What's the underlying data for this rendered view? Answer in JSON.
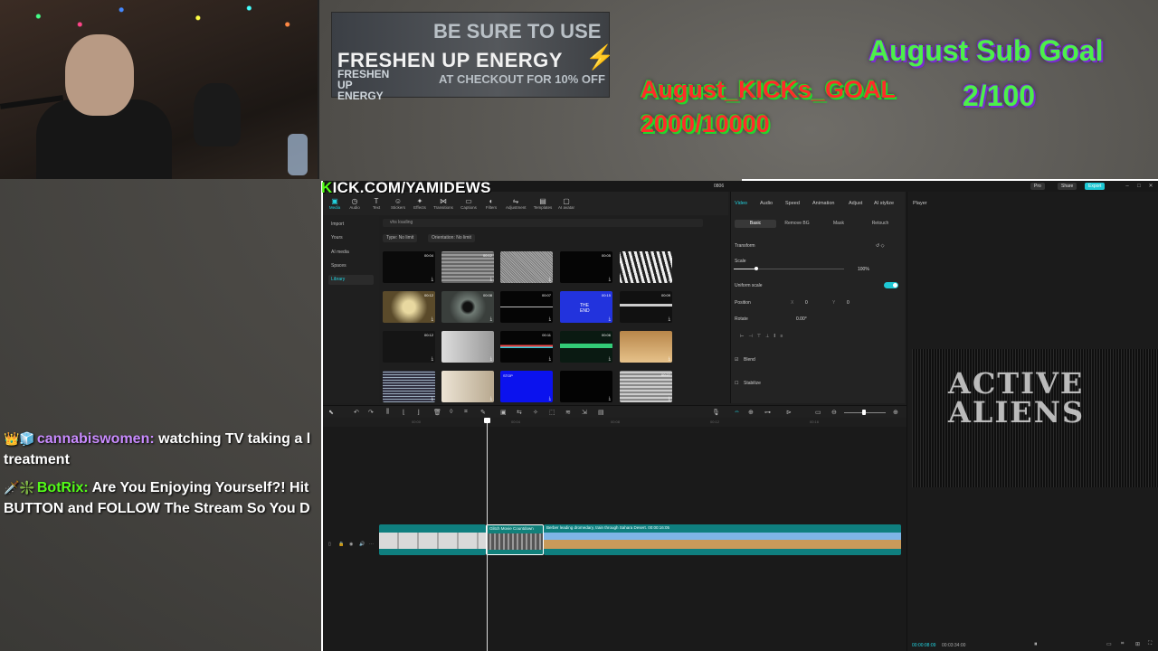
{
  "overlay": {
    "banner": {
      "be_sure": "BE SURE TO USE",
      "brand": "FRESHEN UP ENERGY",
      "brand_small": "FRESHEN UP ENERGY",
      "checkout": "AT CHECKOUT FOR 10% OFF"
    },
    "sub_goal": {
      "title": "August Sub Goal",
      "value": "2/100"
    },
    "kicks_goal": {
      "title": "August_KICKs_GOAL",
      "value": "2000/10000"
    },
    "kick_url_k": "K",
    "kick_url_rest": "ICK.COM/YAMIDEWS"
  },
  "chat": [
    {
      "badges": "👑🧊",
      "user": "cannabiswomen:",
      "text": " watching TV taking a l",
      "text2": "treatment"
    },
    {
      "badges": "🗡️❇️",
      "user": "BotRix:",
      "text": " Are You Enjoying Yourself?! Hit",
      "text2": "BUTTON and FOLLOW The Stream So You D"
    }
  ],
  "editor": {
    "center_title": "0806",
    "pro": "Pro",
    "share": "Share",
    "export": "Export",
    "media_tabs": [
      "Media",
      "Audio",
      "Text",
      "Stickers",
      "Effects",
      "Transitions",
      "Captions",
      "Filters",
      "Adjustment",
      "Templates",
      "AI avatar"
    ],
    "library_items": [
      "Import",
      "Yours",
      "AI media",
      "Spaces",
      "Library"
    ],
    "search_text": "vhs loading",
    "filters": [
      "Type: No limit",
      "Orientation: No limit"
    ],
    "thumbs": [
      {
        "dur": "00:04"
      },
      {
        "dur": "00:12"
      },
      {
        "dur": ""
      },
      {
        "dur": "00:05"
      },
      {
        "dur": ""
      },
      {
        "dur": "00:12"
      },
      {
        "dur": "00:08"
      },
      {
        "dur": "00:07"
      },
      {
        "dur": "00:15"
      },
      {
        "dur": "00:09"
      },
      {
        "dur": "00:12"
      },
      {
        "dur": ""
      },
      {
        "dur": "00:11"
      },
      {
        "dur": "00:06"
      },
      {
        "dur": ""
      },
      {
        "dur": ""
      },
      {
        "dur": ""
      },
      {
        "dur": ""
      },
      {
        "dur": ""
      },
      {
        "dur": "00:27"
      }
    ],
    "thumb_texts": {
      "the_end": "THE END",
      "stop": "STOP"
    },
    "inspector": {
      "tabs": [
        "Video",
        "Audio",
        "Speed",
        "Animation",
        "Adjust",
        "AI stylize"
      ],
      "subtabs": [
        "Basic",
        "Remove BG",
        "Mask",
        "Retouch"
      ],
      "transform": "Transform",
      "scale": "Scale",
      "scale_value": "100%",
      "uniform_scale": "Uniform scale",
      "position": "Position",
      "pos_x_label": "X",
      "pos_x": "0",
      "pos_y_label": "Y",
      "pos_y": "0",
      "rotate": "Rotate",
      "rotate_value": "0.00°",
      "blend": "Blend",
      "stabilize": "Stabilize"
    },
    "player": {
      "label": "Player",
      "glitch_text": "ACTIVE ALIENS",
      "time_current": "00:00:08:09",
      "time_total": "00:03:34:00"
    },
    "ruler": [
      "00:00",
      "00:04",
      "00:08",
      "00:12",
      "00:16"
    ],
    "clips": {
      "b_label": "Glitch Movie Countdown",
      "c_label": "Berber leading dromedary, train through Sahara Desert.   00:00:16:05"
    }
  },
  "colors": {
    "accent": "#22d3e0",
    "kick_green": "#53fc18",
    "goal_green": "#4cf04a",
    "goal_red": "#ff2b2b"
  }
}
